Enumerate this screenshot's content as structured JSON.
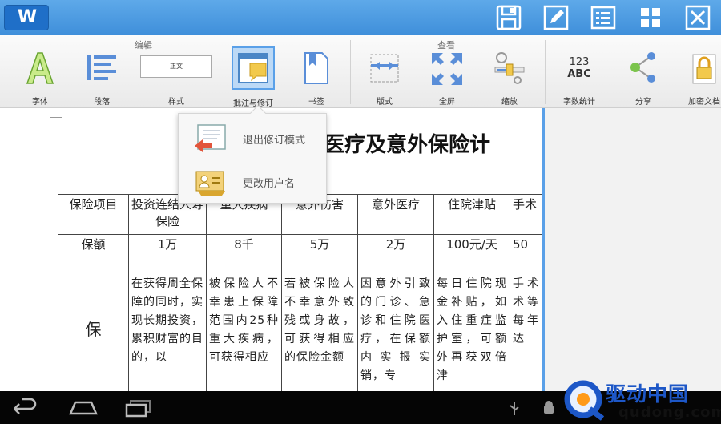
{
  "app": {
    "logo_text": "W"
  },
  "ribbon": {
    "group_edit": "编辑",
    "group_view": "查看",
    "items": [
      {
        "id": "font",
        "label": "字体"
      },
      {
        "id": "paragraph",
        "label": "段落"
      },
      {
        "id": "style",
        "label": "样式",
        "preview": "正文"
      },
      {
        "id": "comment",
        "label": "批注与修订"
      },
      {
        "id": "bookmark",
        "label": "书签"
      },
      {
        "id": "layout",
        "label": "版式"
      },
      {
        "id": "fullscreen",
        "label": "全屏"
      },
      {
        "id": "zoom",
        "label": "缩放"
      },
      {
        "id": "wordcount",
        "label": "字数统计",
        "icon_top": "123",
        "icon_bottom": "ABC"
      },
      {
        "id": "share",
        "label": "分享"
      },
      {
        "id": "encrypt",
        "label": "加密文档"
      }
    ]
  },
  "popup": {
    "items": [
      {
        "label": "退出修订模式"
      },
      {
        "label": "更改用户名"
      }
    ]
  },
  "document": {
    "title_visible": "医疗及意外保险计",
    "table": {
      "header": [
        "保险项目",
        "投资连结人寿保险",
        "重大疾病",
        "意外伤害",
        "意外医疗",
        "住院津贴",
        "手术"
      ],
      "amount": [
        "保额",
        "1万",
        "8千",
        "5万",
        "2万",
        "100元/天",
        "50"
      ],
      "body_label": "保",
      "body": [
        "在获得周全保障的同时，实现长期投资，累积财富的目的，以",
        "被保险人不幸患上保障范围内25种重大疾病，可获得相应",
        "若被保险人不幸意外致残或身故，可获得相应的保险金额",
        "因意外引致的门诊、急诊和住院医疗，在保额内实报实销，专",
        "每日住院现金补贴，如入住重症监护室，可额外再获双倍津",
        "手术补贴术等分，每年度可达"
      ]
    }
  },
  "watermark": {
    "brand": "驱动中国",
    "url": "qudong.com"
  },
  "colors": {
    "titlebar": "#4a9be0",
    "accent": "#5aa0e8"
  }
}
